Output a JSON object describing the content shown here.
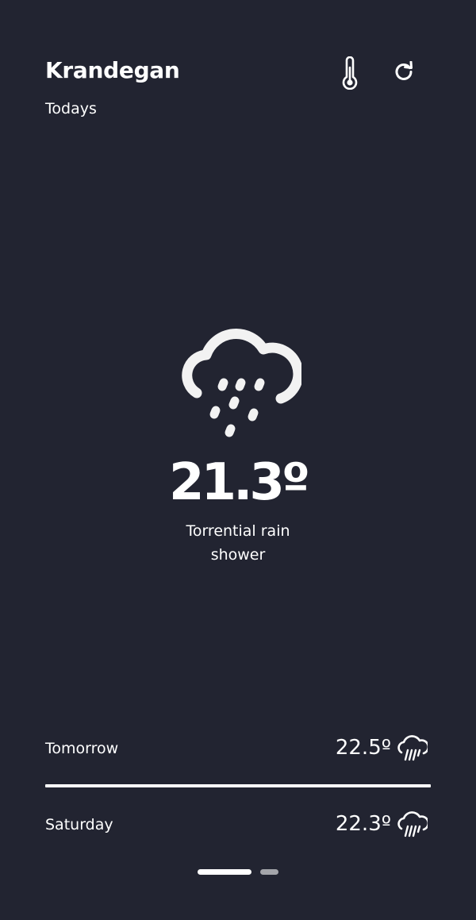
{
  "header": {
    "city": "Krandegan",
    "subtitle": "Todays",
    "thermometer_icon": "thermometer-icon",
    "refresh_icon": "refresh-icon"
  },
  "current": {
    "temperature": "21.3º",
    "condition": "Torrential rain shower",
    "icon": "cloud-heavy-rain-icon"
  },
  "forecast": [
    {
      "day": "Tomorrow",
      "temperature": "22.5º",
      "icon": "cloud-rain-icon"
    },
    {
      "day": "Saturday",
      "temperature": "22.3º",
      "icon": "cloud-rain-icon"
    }
  ],
  "pager": {
    "pages": 2,
    "active_index": 0
  },
  "colors": {
    "background": "#222431",
    "foreground": "#ffffff",
    "inactive_dot": "#a4a5aa"
  }
}
